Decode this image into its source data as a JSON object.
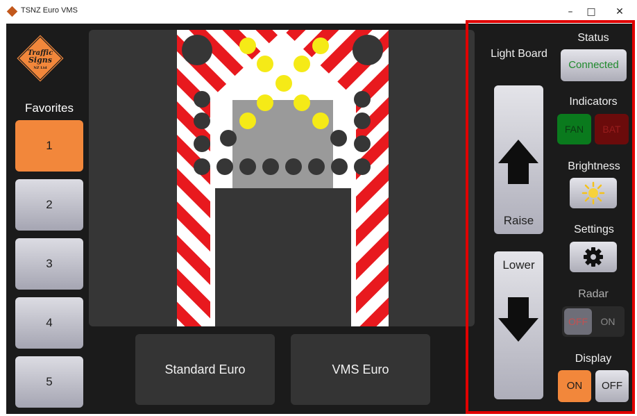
{
  "window": {
    "title": "TSNZ Euro VMS",
    "minimize": "–",
    "maximize": "□",
    "close": "✕"
  },
  "logo": {
    "line1": "Traffic",
    "line2": "Signs",
    "line3": "NZ Ltd"
  },
  "favorites": {
    "title": "Favorites",
    "items": [
      "1",
      "2",
      "3",
      "4",
      "5"
    ],
    "active_index": 0
  },
  "modes": {
    "standard": "Standard Euro",
    "vms": "VMS Euro"
  },
  "panel": {
    "light_board": "Light Board",
    "raise": "Raise",
    "lower": "Lower",
    "status": {
      "label": "Status",
      "value": "Connected"
    },
    "indicators": {
      "label": "Indicators",
      "fan": "FAN",
      "bat": "BAT"
    },
    "brightness": {
      "label": "Brightness"
    },
    "settings": {
      "label": "Settings"
    },
    "radar": {
      "label": "Radar",
      "off": "OFF",
      "on": "ON"
    },
    "display": {
      "label": "Display",
      "on": "ON",
      "off": "OFF"
    }
  },
  "colors": {
    "accent_orange": "#f2873b",
    "stripe_red": "#e8191e",
    "led_yellow": "#f5ea17",
    "connected_text": "#1f8a2d",
    "fan_green": "#0a7a1d",
    "bat_red": "#6b0b0b",
    "frame_red": "#e00000"
  },
  "icons": [
    "app-icon",
    "logo-diamond",
    "arrow-up-icon",
    "arrow-down-icon",
    "sun-icon",
    "gear-icon"
  ]
}
